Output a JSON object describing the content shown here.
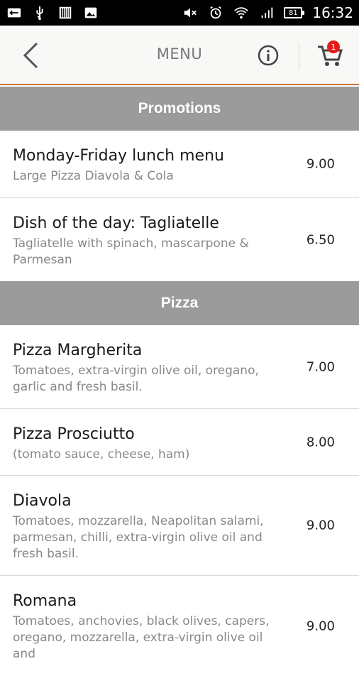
{
  "status_bar": {
    "time": "16:32",
    "battery": "81",
    "left_icons": [
      "keyboard-icon",
      "usb-icon",
      "barcode-icon",
      "image-icon"
    ],
    "right_icons": [
      "mute-icon",
      "alarm-icon",
      "wifi-icon",
      "signal-icon"
    ]
  },
  "app_bar": {
    "title": "MENU",
    "cart_count": "1",
    "accent_color": "#c8733a"
  },
  "sections": [
    {
      "title": "Promotions",
      "items": [
        {
          "name": "Monday-Friday lunch menu",
          "description": "Large Pizza Diavola & Cola",
          "price": "9.00"
        },
        {
          "name": "Dish of the day: Tagliatelle",
          "description": "Tagliatelle with spinach, mascarpone & Parmesan",
          "price": "6.50"
        }
      ]
    },
    {
      "title": "Pizza",
      "items": [
        {
          "name": "Pizza Margherita",
          "description": "Tomatoes, extra-virgin olive oil, oregano, garlic and fresh basil.",
          "price": "7.00"
        },
        {
          "name": "Pizza Prosciutto",
          "description": "(tomato sauce, cheese, ham)",
          "price": "8.00"
        },
        {
          "name": "Diavola",
          "description": "Tomatoes, mozzarella, Neapolitan salami, parmesan, chilli, extra-virgin olive oil and fresh basil.",
          "price": "9.00"
        },
        {
          "name": "Romana",
          "description": "Tomatoes, anchovies, black olives, capers, oregano, mozzarella, extra-virgin olive oil and",
          "price": "9.00"
        }
      ]
    }
  ]
}
